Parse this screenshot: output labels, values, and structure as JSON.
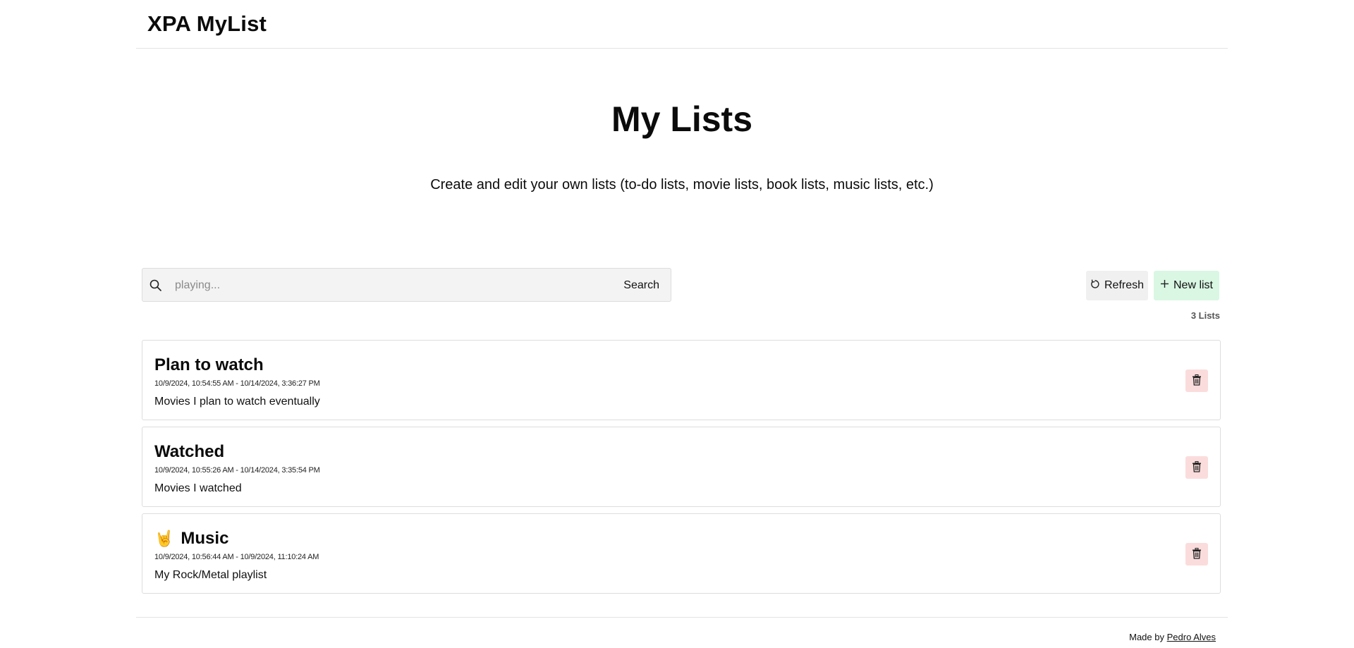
{
  "header": {
    "brand": "XPA MyList"
  },
  "hero": {
    "title": "My Lists",
    "subtitle": "Create and edit your own lists (to-do lists, movie lists, book lists, music lists, etc.)"
  },
  "toolbar": {
    "search_placeholder": "playing...",
    "search_value": "",
    "search_label": "Search",
    "refresh_label": "Refresh",
    "new_list_label": "New list",
    "list_count": "3 Lists"
  },
  "lists": [
    {
      "emoji": "",
      "title": "Plan to watch",
      "dates": "10/9/2024, 10:54:55 AM - 10/14/2024, 3:36:27 PM",
      "description": "Movies I plan to watch eventually"
    },
    {
      "emoji": "",
      "title": "Watched",
      "dates": "10/9/2024, 10:55:26 AM - 10/14/2024, 3:35:54 PM",
      "description": "Movies I watched"
    },
    {
      "emoji": "🤘",
      "title": "Music",
      "dates": "10/9/2024, 10:56:44 AM - 10/9/2024, 11:10:24 AM",
      "description": "My Rock/Metal playlist"
    }
  ],
  "footer": {
    "made_by": "Made by",
    "author": "Pedro Alves"
  },
  "icons": {
    "search": "search-icon",
    "refresh": "refresh-icon",
    "plus": "plus-icon",
    "trash": "trash-icon"
  },
  "colors": {
    "new_list_bg": "#d9f7e3",
    "refresh_bg": "#f0f0f0",
    "delete_bg": "#fbdcdc",
    "search_bg": "#f3f3f3"
  }
}
